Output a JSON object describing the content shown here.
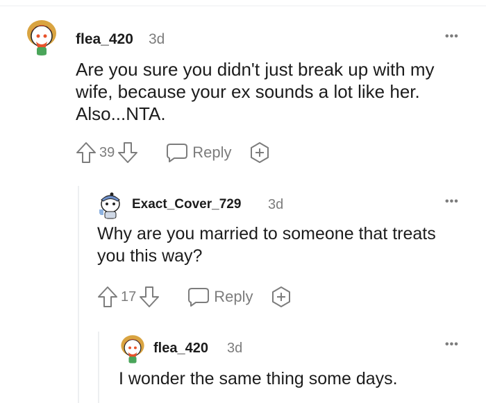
{
  "comments": [
    {
      "username": "flea_420",
      "time": "3d",
      "body": "Are you sure you didn't just break up with my wife, because your ex sounds a lot like her. Also...NTA.",
      "votes": "39",
      "reply_label": "Reply",
      "more_label": "•••",
      "avatar_icon": "redditor-avatar-orange-hair"
    },
    {
      "username": "Exact_Cover_729",
      "time": "3d",
      "body": "Why are you married to someone that treats you this way?",
      "votes": "17",
      "reply_label": "Reply",
      "more_label": "•••",
      "avatar_icon": "redditor-avatar-blue-cap"
    },
    {
      "username": "flea_420",
      "time": "3d",
      "body": "I wonder the same thing some days.",
      "more_label": "•••",
      "avatar_icon": "redditor-avatar-orange-hair"
    }
  ],
  "colors": {
    "text": "#1c1c1c",
    "meta": "#7c7c7c",
    "thread_line": "#edeff1"
  }
}
